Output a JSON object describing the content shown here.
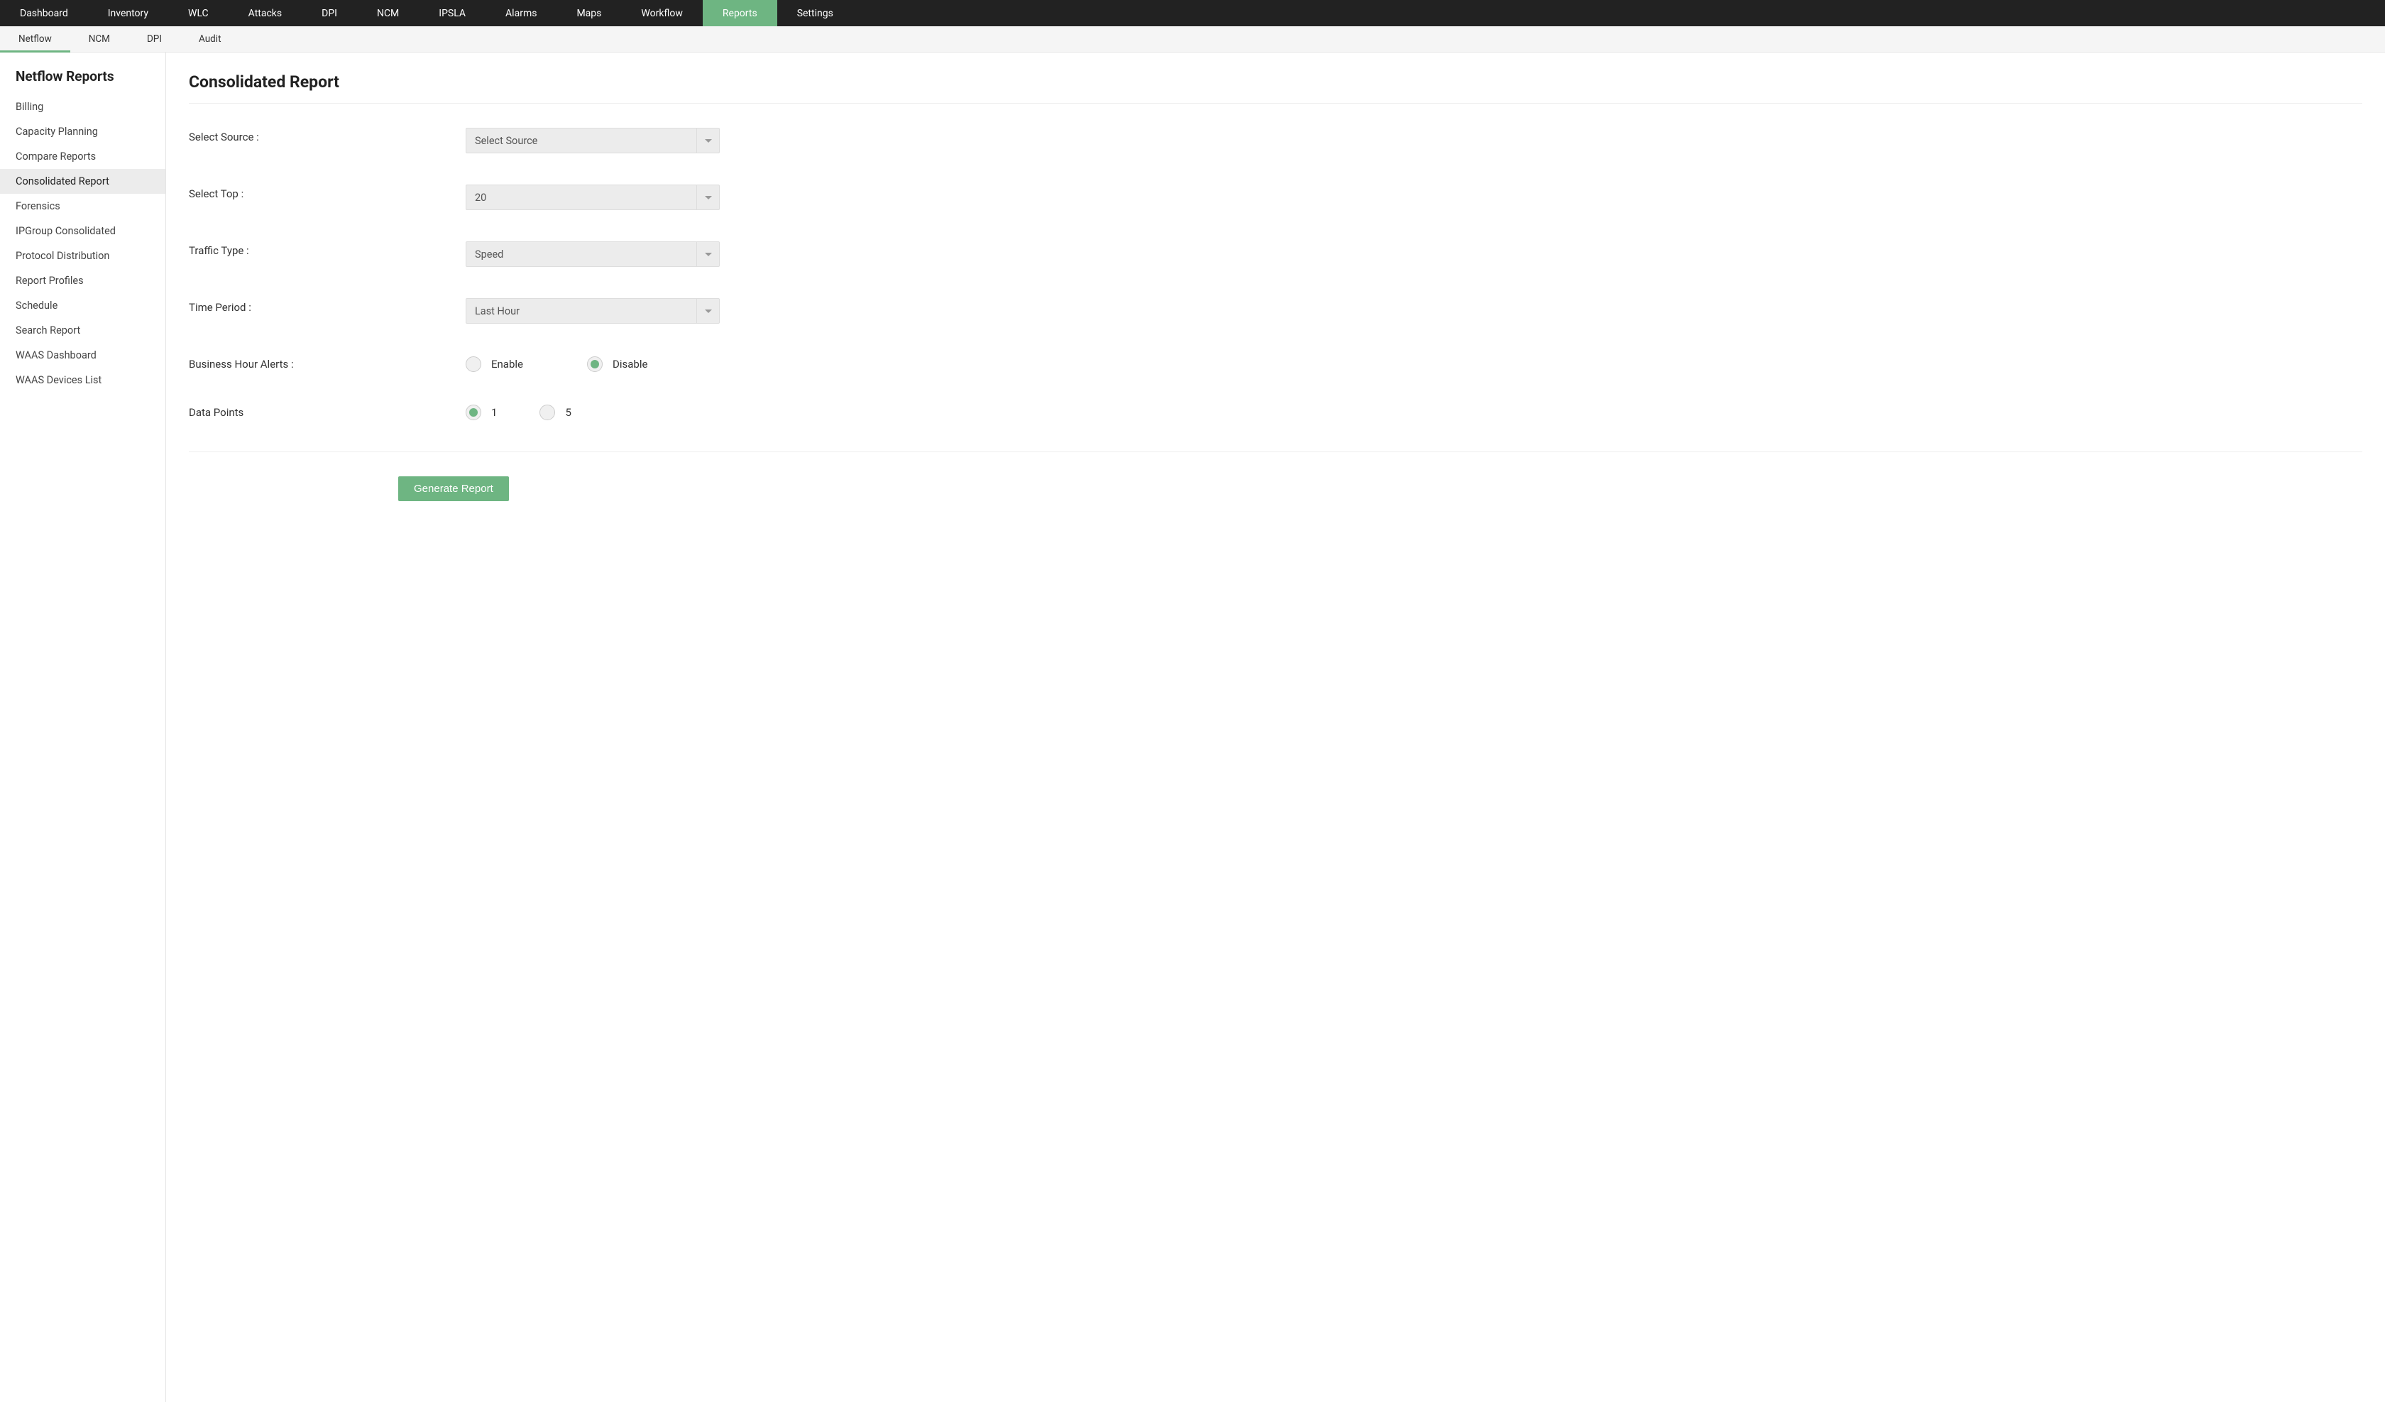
{
  "topnav": {
    "items": [
      {
        "label": "Dashboard"
      },
      {
        "label": "Inventory"
      },
      {
        "label": "WLC"
      },
      {
        "label": "Attacks"
      },
      {
        "label": "DPI"
      },
      {
        "label": "NCM"
      },
      {
        "label": "IPSLA"
      },
      {
        "label": "Alarms"
      },
      {
        "label": "Maps"
      },
      {
        "label": "Workflow"
      },
      {
        "label": "Reports"
      },
      {
        "label": "Settings"
      }
    ]
  },
  "subnav": {
    "items": [
      {
        "label": "Netflow"
      },
      {
        "label": "NCM"
      },
      {
        "label": "DPI"
      },
      {
        "label": "Audit"
      }
    ]
  },
  "sidebar": {
    "title": "Netflow Reports",
    "items": [
      {
        "label": "Billing"
      },
      {
        "label": "Capacity Planning"
      },
      {
        "label": "Compare Reports"
      },
      {
        "label": "Consolidated Report"
      },
      {
        "label": "Forensics"
      },
      {
        "label": "IPGroup Consolidated"
      },
      {
        "label": "Protocol Distribution"
      },
      {
        "label": "Report Profiles"
      },
      {
        "label": "Schedule"
      },
      {
        "label": "Search Report"
      },
      {
        "label": "WAAS Dashboard"
      },
      {
        "label": "WAAS Devices List"
      }
    ]
  },
  "page": {
    "title": "Consolidated Report"
  },
  "form": {
    "source": {
      "label": "Select Source :",
      "value": "Select Source"
    },
    "top": {
      "label": "Select Top :",
      "value": "20"
    },
    "traffic": {
      "label": "Traffic Type :",
      "value": "Speed"
    },
    "period": {
      "label": "Time Period :",
      "value": "Last Hour"
    },
    "bha": {
      "label": "Business Hour Alerts :",
      "enable": "Enable",
      "disable": "Disable"
    },
    "datapoints": {
      "label": "Data Points",
      "opt1": "1",
      "opt5": "5"
    },
    "submit": "Generate Report"
  }
}
